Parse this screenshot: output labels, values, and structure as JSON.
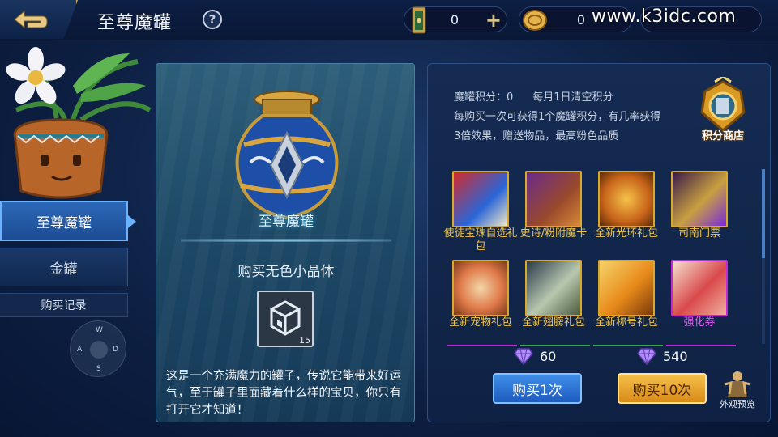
{
  "header": {
    "title": "至尊魔罐",
    "help": "?",
    "currency1": {
      "value": "0",
      "icon": "ticket-icon"
    },
    "currency2": {
      "value": "0",
      "icon": "coin-icon"
    },
    "currency3": {
      "value": "",
      "icon": "diamond-icon"
    },
    "plus": "+",
    "watermark": "www.k3idc.com"
  },
  "sidebar": {
    "items": [
      {
        "label": "至尊魔罐"
      },
      {
        "label": "金罐"
      }
    ],
    "record": "购买记录",
    "joystick": {
      "w": "W",
      "a": "A",
      "s": "S",
      "d": "D"
    }
  },
  "main": {
    "jar_name": "至尊魔罐",
    "buy_text": "购买无色小晶体",
    "crystal_count": "15",
    "description": "这是一个充满魔力的罐子，传说它能带来好运气，至于罐子里面藏着什么样的宝贝，你只有打开它才知道！"
  },
  "right": {
    "points_label": "魔罐积分：0",
    "clear_note": "每月1日清空积分",
    "info": "每购买一次可获得1个魔罐积分，有几率获得3倍效果，赠送物品，最高粉色品质",
    "shop": "积分商店",
    "items": [
      {
        "label": "使徒宝珠自选礼包",
        "rarity": "gold"
      },
      {
        "label": "史诗/粉附魔卡",
        "rarity": "gold"
      },
      {
        "label": "全新光环礼包",
        "rarity": "gold"
      },
      {
        "label": "司南门票",
        "rarity": "gold"
      },
      {
        "label": "全新宠物礼包",
        "rarity": "gold"
      },
      {
        "label": "全新翅膀礼包",
        "rarity": "gold"
      },
      {
        "label": "全新称号礼包",
        "rarity": "gold"
      },
      {
        "label": "强化券",
        "rarity": "purple"
      }
    ],
    "price1": "60",
    "price2": "540",
    "buy1": "购买1次",
    "buy10": "购买10次",
    "preview": "外观预览"
  },
  "colors": {
    "gold": "#f2c64a",
    "purple": "#e05cf2",
    "accent_blue": "#2c68b8"
  }
}
